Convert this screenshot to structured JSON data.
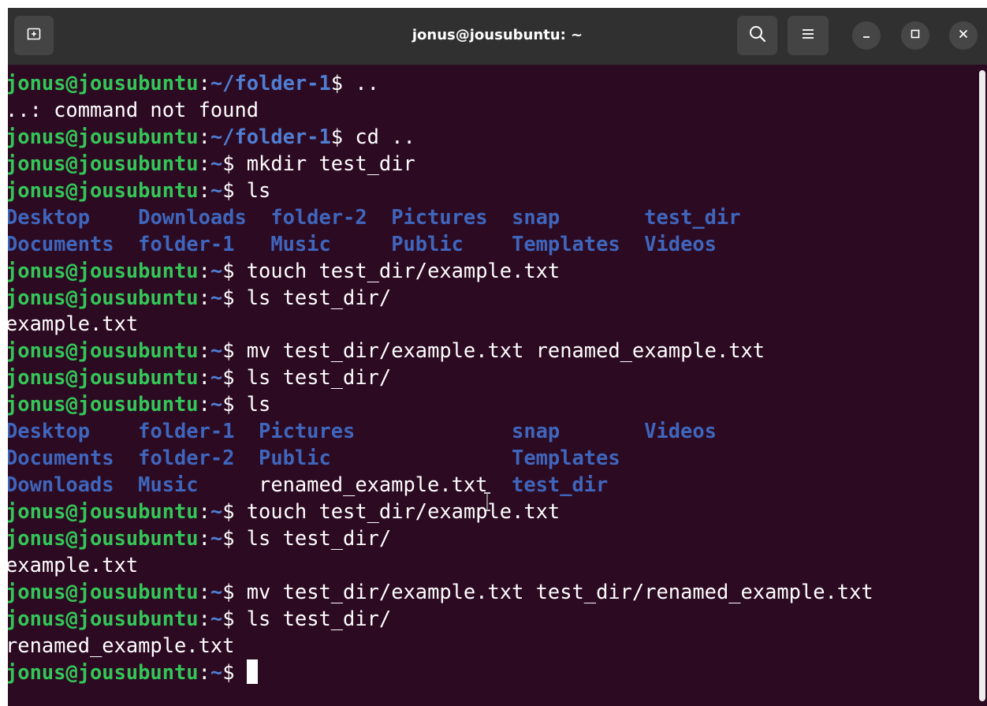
{
  "window": {
    "title": "jonus@jousubuntu: ~",
    "icons": {
      "new_tab": "new-tab-icon",
      "search": "search-icon",
      "menu": "hamburger-menu-icon",
      "minimize": "minimize-icon",
      "maximize": "maximize-icon",
      "close": "close-icon"
    }
  },
  "colors": {
    "terminal_bg": "#2c0a22",
    "titlebar_bg": "#303030",
    "user_host": "#34c758",
    "path": "#4f7ed3",
    "directory": "#3f66bd",
    "text": "#ffffff"
  },
  "terminal": {
    "lines": [
      {
        "type": "prompt",
        "user": "jonus@jousubuntu",
        "path": "~/folder-1",
        "cmd": " .."
      },
      {
        "type": "output",
        "text": "..: command not found"
      },
      {
        "type": "prompt",
        "user": "jonus@jousubuntu",
        "path": "~/folder-1",
        "cmd": " cd .."
      },
      {
        "type": "prompt",
        "user": "jonus@jousubuntu",
        "path": "~",
        "cmd": " mkdir test_dir"
      },
      {
        "type": "prompt",
        "user": "jonus@jousubuntu",
        "path": "~",
        "cmd": " ls"
      },
      {
        "type": "ls",
        "cells": [
          {
            "t": "Desktop    ",
            "d": true
          },
          {
            "t": "Downloads  ",
            "d": true
          },
          {
            "t": "folder-2  ",
            "d": true
          },
          {
            "t": "Pictures  ",
            "d": true
          },
          {
            "t": "snap       ",
            "d": true
          },
          {
            "t": "test_dir",
            "d": true
          }
        ]
      },
      {
        "type": "ls",
        "cells": [
          {
            "t": "Documents  ",
            "d": true
          },
          {
            "t": "folder-1   ",
            "d": true
          },
          {
            "t": "Music     ",
            "d": true
          },
          {
            "t": "Public    ",
            "d": true
          },
          {
            "t": "Templates  ",
            "d": true
          },
          {
            "t": "Videos",
            "d": true
          }
        ]
      },
      {
        "type": "prompt",
        "user": "jonus@jousubuntu",
        "path": "~",
        "cmd": " touch test_dir/example.txt"
      },
      {
        "type": "prompt",
        "user": "jonus@jousubuntu",
        "path": "~",
        "cmd": " ls test_dir/"
      },
      {
        "type": "output",
        "text": "example.txt"
      },
      {
        "type": "prompt",
        "user": "jonus@jousubuntu",
        "path": "~",
        "cmd": " mv test_dir/example.txt renamed_example.txt"
      },
      {
        "type": "prompt",
        "user": "jonus@jousubuntu",
        "path": "~",
        "cmd": " ls test_dir/"
      },
      {
        "type": "prompt",
        "user": "jonus@jousubuntu",
        "path": "~",
        "cmd": " ls"
      },
      {
        "type": "ls",
        "cells": [
          {
            "t": "Desktop    ",
            "d": true
          },
          {
            "t": "folder-1  ",
            "d": true
          },
          {
            "t": "Pictures             ",
            "d": true
          },
          {
            "t": "snap       ",
            "d": true
          },
          {
            "t": "Videos",
            "d": true
          }
        ]
      },
      {
        "type": "ls",
        "cells": [
          {
            "t": "Documents  ",
            "d": true
          },
          {
            "t": "folder-2  ",
            "d": true
          },
          {
            "t": "Public               ",
            "d": true
          },
          {
            "t": "Templates",
            "d": true
          }
        ]
      },
      {
        "type": "ls",
        "cells": [
          {
            "t": "Downloads  ",
            "d": true
          },
          {
            "t": "Music     ",
            "d": true
          },
          {
            "t": "renamed_example.txt  ",
            "d": false
          },
          {
            "t": "test_dir",
            "d": true
          }
        ]
      },
      {
        "type": "prompt",
        "user": "jonus@jousubuntu",
        "path": "~",
        "cmd": " touch test_dir/example.txt"
      },
      {
        "type": "prompt",
        "user": "jonus@jousubuntu",
        "path": "~",
        "cmd": " ls test_dir/"
      },
      {
        "type": "output",
        "text": "example.txt"
      },
      {
        "type": "prompt",
        "user": "jonus@jousubuntu",
        "path": "~",
        "cmd": " mv test_dir/example.txt test_dir/renamed_example.txt"
      },
      {
        "type": "prompt",
        "user": "jonus@jousubuntu",
        "path": "~",
        "cmd": " ls test_dir/"
      },
      {
        "type": "output",
        "text": "renamed_example.txt"
      },
      {
        "type": "prompt",
        "user": "jonus@jousubuntu",
        "path": "~",
        "cmd": " ",
        "cursor": true
      }
    ]
  }
}
